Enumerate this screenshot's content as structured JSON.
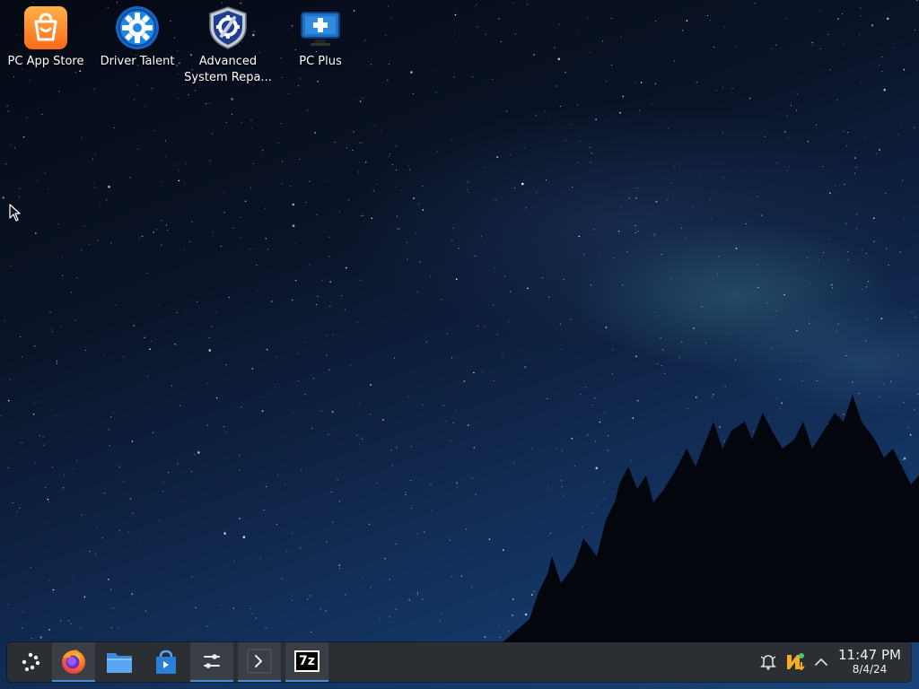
{
  "desktop": {
    "icons": [
      {
        "name": "pc-app-store-icon",
        "label": "PC App Store"
      },
      {
        "name": "driver-talent-icon",
        "label": "Driver Talent"
      },
      {
        "name": "advanced-system-repair-icon",
        "label": "Advanced System Repa..."
      },
      {
        "name": "pc-plus-icon",
        "label": "PC Plus"
      }
    ]
  },
  "taskbar": {
    "launchers": [
      {
        "name": "application-launcher-icon"
      },
      {
        "name": "firefox-icon"
      },
      {
        "name": "file-manager-icon"
      },
      {
        "name": "app-store-icon"
      },
      {
        "name": "system-settings-icon"
      },
      {
        "name": "terminal-icon"
      },
      {
        "name": "7zip-icon",
        "text": "7z"
      }
    ],
    "tray": {
      "icons": [
        "notifications-icon",
        "update-manager-icon",
        "show-hidden-icons-chevron-icon"
      ]
    },
    "clock": {
      "time": "11:47 PM",
      "date": "8/4/24"
    }
  },
  "colors": {
    "taskbar_bg": "#2b2e33",
    "accent": "#4a8fd6",
    "sky_top": "#050914",
    "sky_bottom": "#1a4478"
  }
}
